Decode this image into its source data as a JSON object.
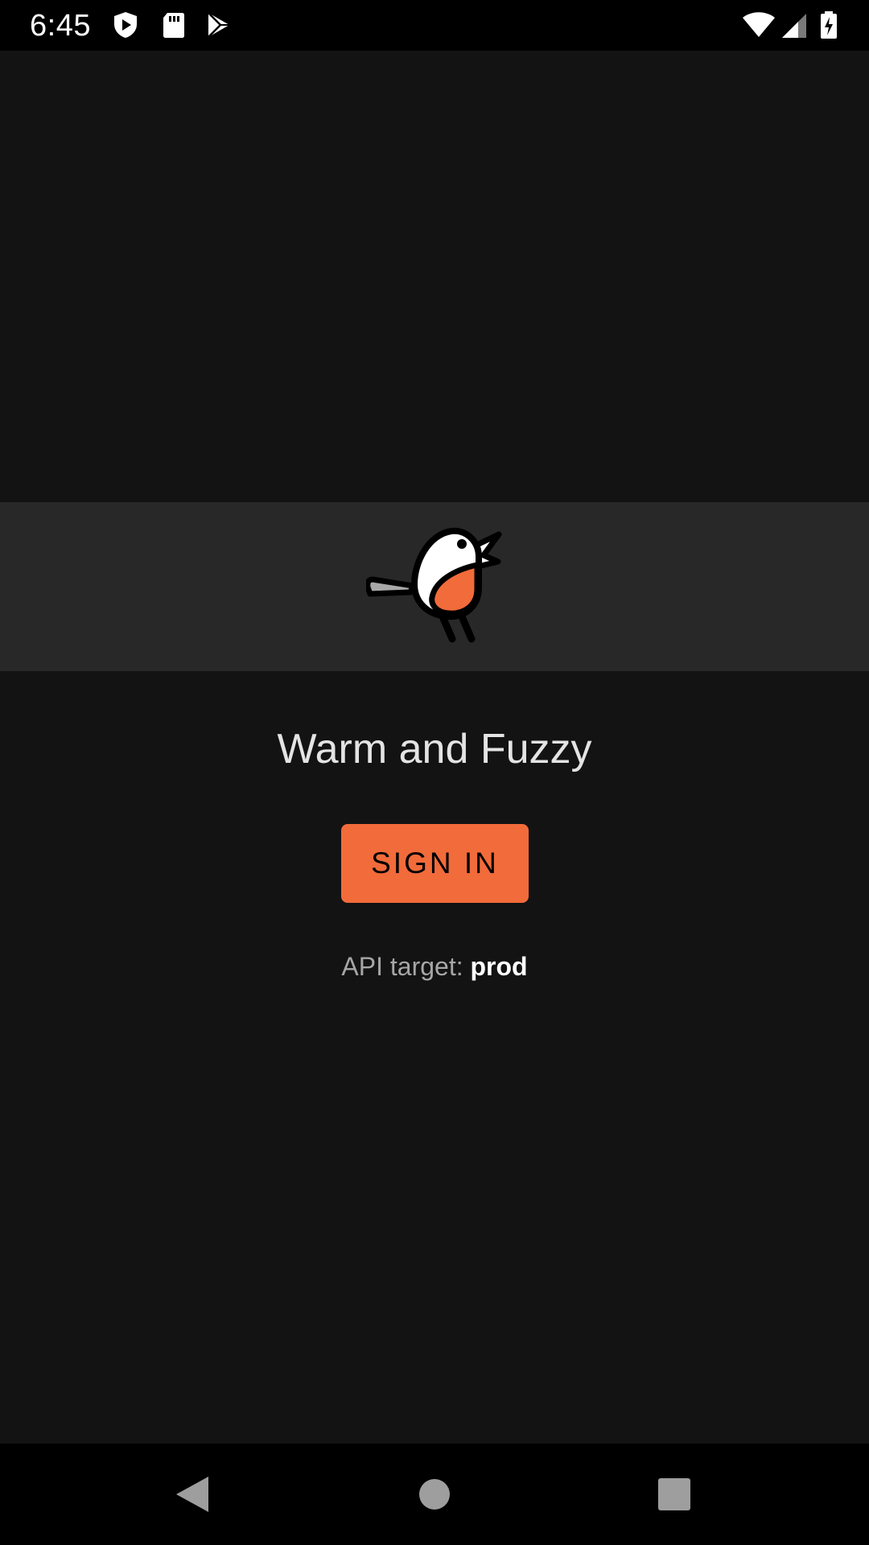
{
  "status_bar": {
    "time": "6:45",
    "left_icons": [
      "shield-play-icon",
      "sd-card-icon",
      "play-store-icon"
    ],
    "right_icons": [
      "wifi-icon",
      "cell-signal-icon",
      "battery-charging-icon"
    ]
  },
  "app": {
    "title": "Warm and Fuzzy",
    "logo_icon": "robin-bird-icon",
    "sign_in_label": "SIGN IN",
    "api_target_label": "API target:",
    "api_target_value": "prod"
  },
  "nav_bar": {
    "buttons": [
      "back-icon",
      "home-icon",
      "recents-icon"
    ]
  },
  "colors": {
    "background": "#131313",
    "hero_band": "#282828",
    "accent": "#f26b3a",
    "title_text": "#e4e4e4",
    "secondary_text": "#a6a6a6"
  }
}
